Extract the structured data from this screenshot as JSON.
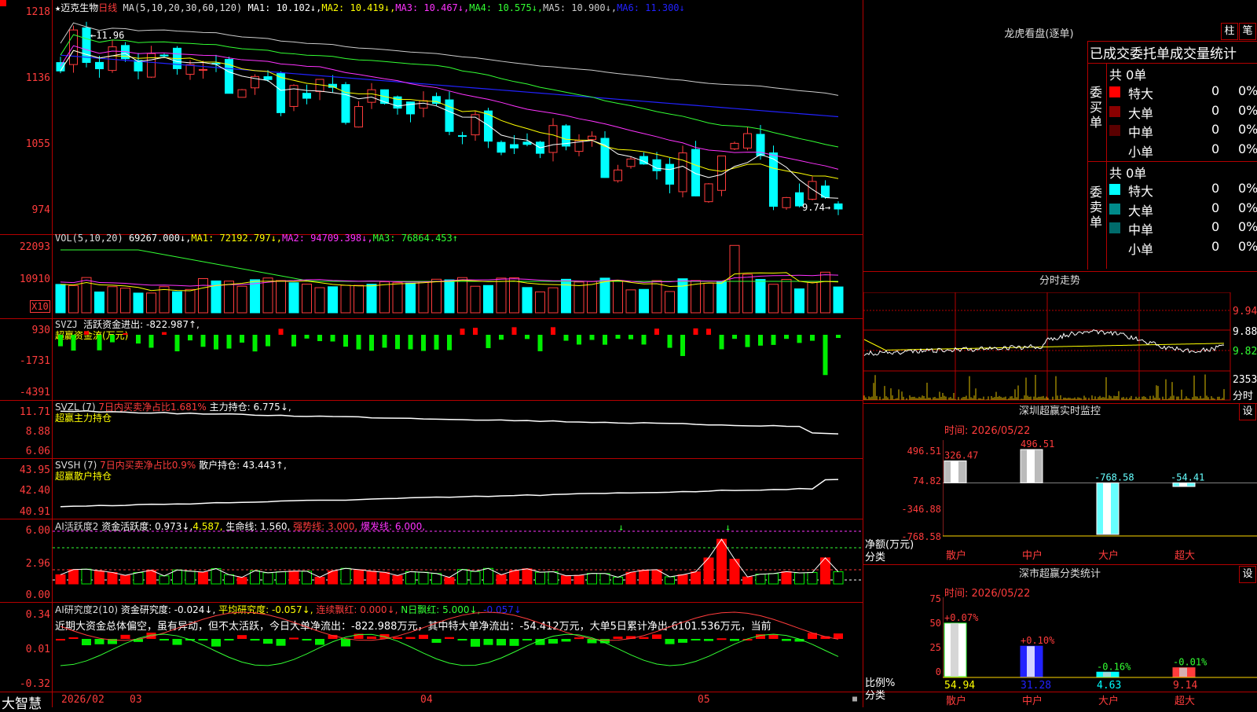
{
  "app_name": "大智慧",
  "stock_name": "迈克生物",
  "period": "日线",
  "main": {
    "ma_label": "MA(5,10,20,30,60,120)",
    "ma": [
      {
        "label": "MA1: 10.102↓,",
        "color": "#ffffff"
      },
      {
        "label": "MA2: 10.419↓,",
        "color": "#ffff00"
      },
      {
        "label": "MA3: 10.467↓,",
        "color": "#ff33ff"
      },
      {
        "label": "MA4: 10.575↓,",
        "color": "#33ff33"
      },
      {
        "label": "MA5: 10.900↓,",
        "color": "#cccccc"
      },
      {
        "label": "MA6: 11.300↓",
        "color": "#2222ff"
      }
    ],
    "y_ticks": [
      "1218",
      "1136",
      "1055",
      "974"
    ],
    "high_label": "11.96",
    "low_label": "9.74"
  },
  "vol": {
    "label": "VOL(5,10,20)",
    "value": "69267.000↓,",
    "ma": [
      {
        "label": "MA1: 72192.797↓,",
        "color": "#ffff00"
      },
      {
        "label": "MA2: 94709.398↓,",
        "color": "#ff33ff"
      },
      {
        "label": "MA3: 76864.453↑",
        "color": "#33ff33"
      }
    ],
    "y_ticks": [
      "22093",
      "10910"
    ],
    "unit": "X10"
  },
  "svzj": {
    "label": "SVZJ",
    "desc": "活跃资金进出: -822.987↑,",
    "sub": "超赢资金流(万元)",
    "y_ticks": [
      "930",
      "-1731",
      "-4391"
    ]
  },
  "svzl": {
    "label": "SVZL (7)",
    "desc": "7日内买卖净占比1.681%",
    "desc2": "主力持仓: 6.775↓,",
    "sub": "超赢主力持仓",
    "y_ticks": [
      "11.71",
      "8.88",
      "6.06"
    ]
  },
  "svsh": {
    "label": "SVSH (7)",
    "desc": "7日内买卖净占比0.9%",
    "desc2": "散户持仓: 43.443↑,",
    "sub": "超赢散户持仓",
    "y_ticks": [
      "43.95",
      "42.40",
      "40.91"
    ]
  },
  "ai_active": {
    "label": "AI活跃度2",
    "desc": "资金活跃度: 0.973↓,",
    "desc2": "4.587,",
    "desc3": "生命线: 1.560,",
    "desc4": "强势线: 3.000,",
    "desc5": "爆发线: 6.000,",
    "y_ticks": [
      "6.00",
      "2.96",
      "0.00"
    ]
  },
  "ai_research": {
    "label": "AI研究度2(10)",
    "desc": "资金研究度: -0.024↓,",
    "desc2": "平均研究度: -0.057↓,",
    "desc3": "连续飘红: 0.000↓,",
    "desc4": "N日飘红: 5.000↓,",
    "desc5": "-0.057↓",
    "comment": "近期大资金总体偏空，虽有异动，但不太活跃，今日大单净流出：-822.988万元，其中特大单净流出：-54.412万元，大单5日累计净出-6101.536万元，当前",
    "y_ticks": [
      "0.34",
      "0.01",
      "-0.32"
    ]
  },
  "x_axis": {
    "labels": [
      "2026/02",
      "03",
      "04",
      "05"
    ]
  },
  "dragon_tiger": {
    "title": "龙虎看盘(逐单)",
    "btn1": "柱",
    "btn2": "笔",
    "table_title": "已成交委托单成交量统计",
    "buy": {
      "side": "委买单",
      "total": "共 0单",
      "rows": [
        {
          "name": "特大",
          "count": "0",
          "pct": "0%",
          "color": "#ff0000"
        },
        {
          "name": "大单",
          "count": "0",
          "pct": "0%",
          "color": "#8b0000"
        },
        {
          "name": "中单",
          "count": "0",
          "pct": "0%",
          "color": "#5a0000"
        },
        {
          "name": "小单",
          "count": "0",
          "pct": "0%",
          "color": ""
        }
      ]
    },
    "sell": {
      "side": "委卖单",
      "total": "共 0单",
      "rows": [
        {
          "name": "特大",
          "count": "0",
          "pct": "0%",
          "color": "#00ffff"
        },
        {
          "name": "大单",
          "count": "0",
          "pct": "0%",
          "color": "#008b8b"
        },
        {
          "name": "中单",
          "count": "0",
          "pct": "0%",
          "color": "#006b6b"
        },
        {
          "name": "小单",
          "count": "0",
          "pct": "0%",
          "color": ""
        }
      ]
    }
  },
  "intraday": {
    "title": "分时走势",
    "prices": [
      "9.94",
      "9.88",
      "9.82"
    ],
    "vol_label": "2353",
    "time_label": "分时"
  },
  "monitor": {
    "title": "深圳超赢实时监控",
    "set_btn": "设",
    "time": "时间: 2026/05/22",
    "y_ticks": [
      "496.51",
      "74.82",
      "-346.88",
      "-768.58"
    ],
    "y_unit": "净额(万元)",
    "x_unit": "分类",
    "bars": [
      {
        "category": "散户",
        "value": 326.47,
        "label": "326.47"
      },
      {
        "category": "中户",
        "value": 496.51,
        "label": "496.51"
      },
      {
        "category": "大户",
        "value": -768.58,
        "label": "-768.58"
      },
      {
        "category": "超大",
        "value": -54.41,
        "label": "-54.41"
      }
    ]
  },
  "classify": {
    "title": "深市超赢分类统计",
    "set_btn": "设",
    "time": "时间: 2026/05/22",
    "y_ticks": [
      "75",
      "50",
      "25",
      "0"
    ],
    "y_unit": "比例%",
    "x_unit": "分类",
    "bars": [
      {
        "category": "散户",
        "value": 54.94,
        "label": "54.94",
        "change": "+0.07%"
      },
      {
        "category": "中户",
        "value": 31.28,
        "label": "31.28",
        "change": "+0.10%"
      },
      {
        "category": "大户",
        "value": 4.63,
        "label": "4.63",
        "change": "-0.16%"
      },
      {
        "category": "超大",
        "value": 9.14,
        "label": "9.14",
        "change": "-0.01%"
      }
    ]
  }
}
